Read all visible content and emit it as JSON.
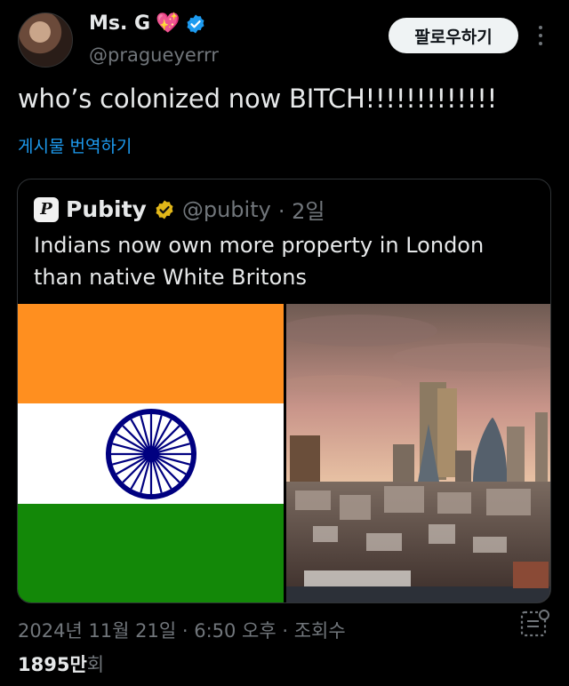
{
  "author": {
    "display_name": "Ms. G",
    "emoji": "💖",
    "handle": "@pragueyerrr"
  },
  "follow_label": "팔로우하기",
  "tweet_text": "who’s colonized now BITCH!!!!!!!!!!!!!",
  "translate_label": "게시물 번역하기",
  "quote": {
    "logo_letter": "P",
    "name": "Pubity",
    "handle": "@pubity",
    "time": "· 2일",
    "text": "Indians now own more property in London than native White Britons"
  },
  "meta": {
    "timestamp": "2024년 11월 21일 · 6:50 오후 · 조회수",
    "views_count": "1895만",
    "views_unit": "회"
  },
  "colors": {
    "saffron": "#FF8F1F",
    "white": "#FFFFFF",
    "green": "#138808",
    "chakra": "#000080",
    "link": "#1d9bf0",
    "verified_blue": "#1d9bf0",
    "verified_gold": "#e2b719"
  }
}
